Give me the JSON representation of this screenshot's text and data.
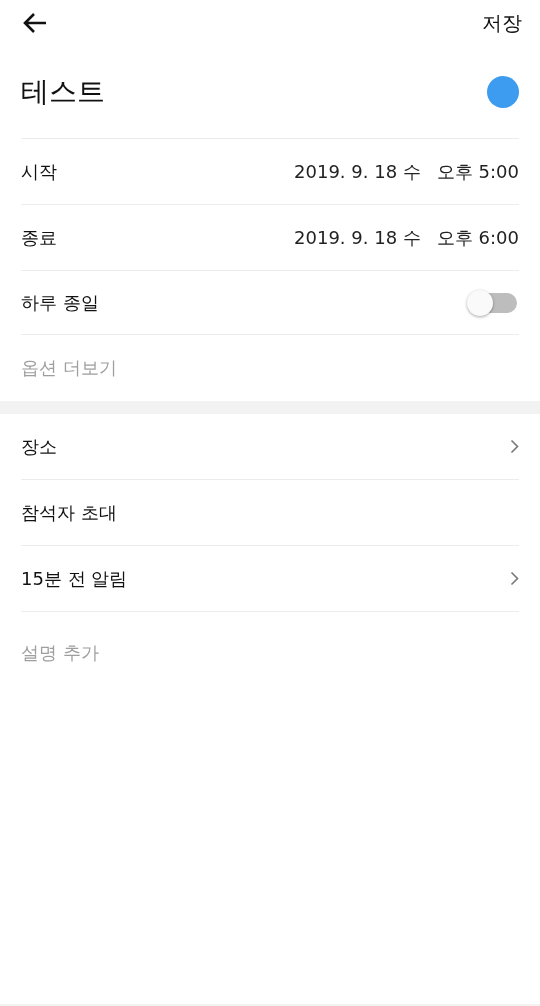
{
  "header": {
    "save_label": "저장"
  },
  "event": {
    "title": "테스트",
    "color": "#3d9cf0"
  },
  "time_rows": [
    {
      "label": "시작",
      "date": "2019. 9. 18 수",
      "time": "오후 5:00"
    },
    {
      "label": "종료",
      "date": "2019. 9. 18 수",
      "time": "오후 6:00"
    }
  ],
  "all_day": {
    "label": "하루 종일",
    "on": false
  },
  "more_options": "옵션 더보기",
  "rows": [
    {
      "label": "장소",
      "kind": "chevron"
    },
    {
      "label": "참석자 초대",
      "kind": "plain"
    },
    {
      "label": "15분 전 알림",
      "kind": "chevron"
    }
  ],
  "description": {
    "placeholder": "설명 추가"
  }
}
